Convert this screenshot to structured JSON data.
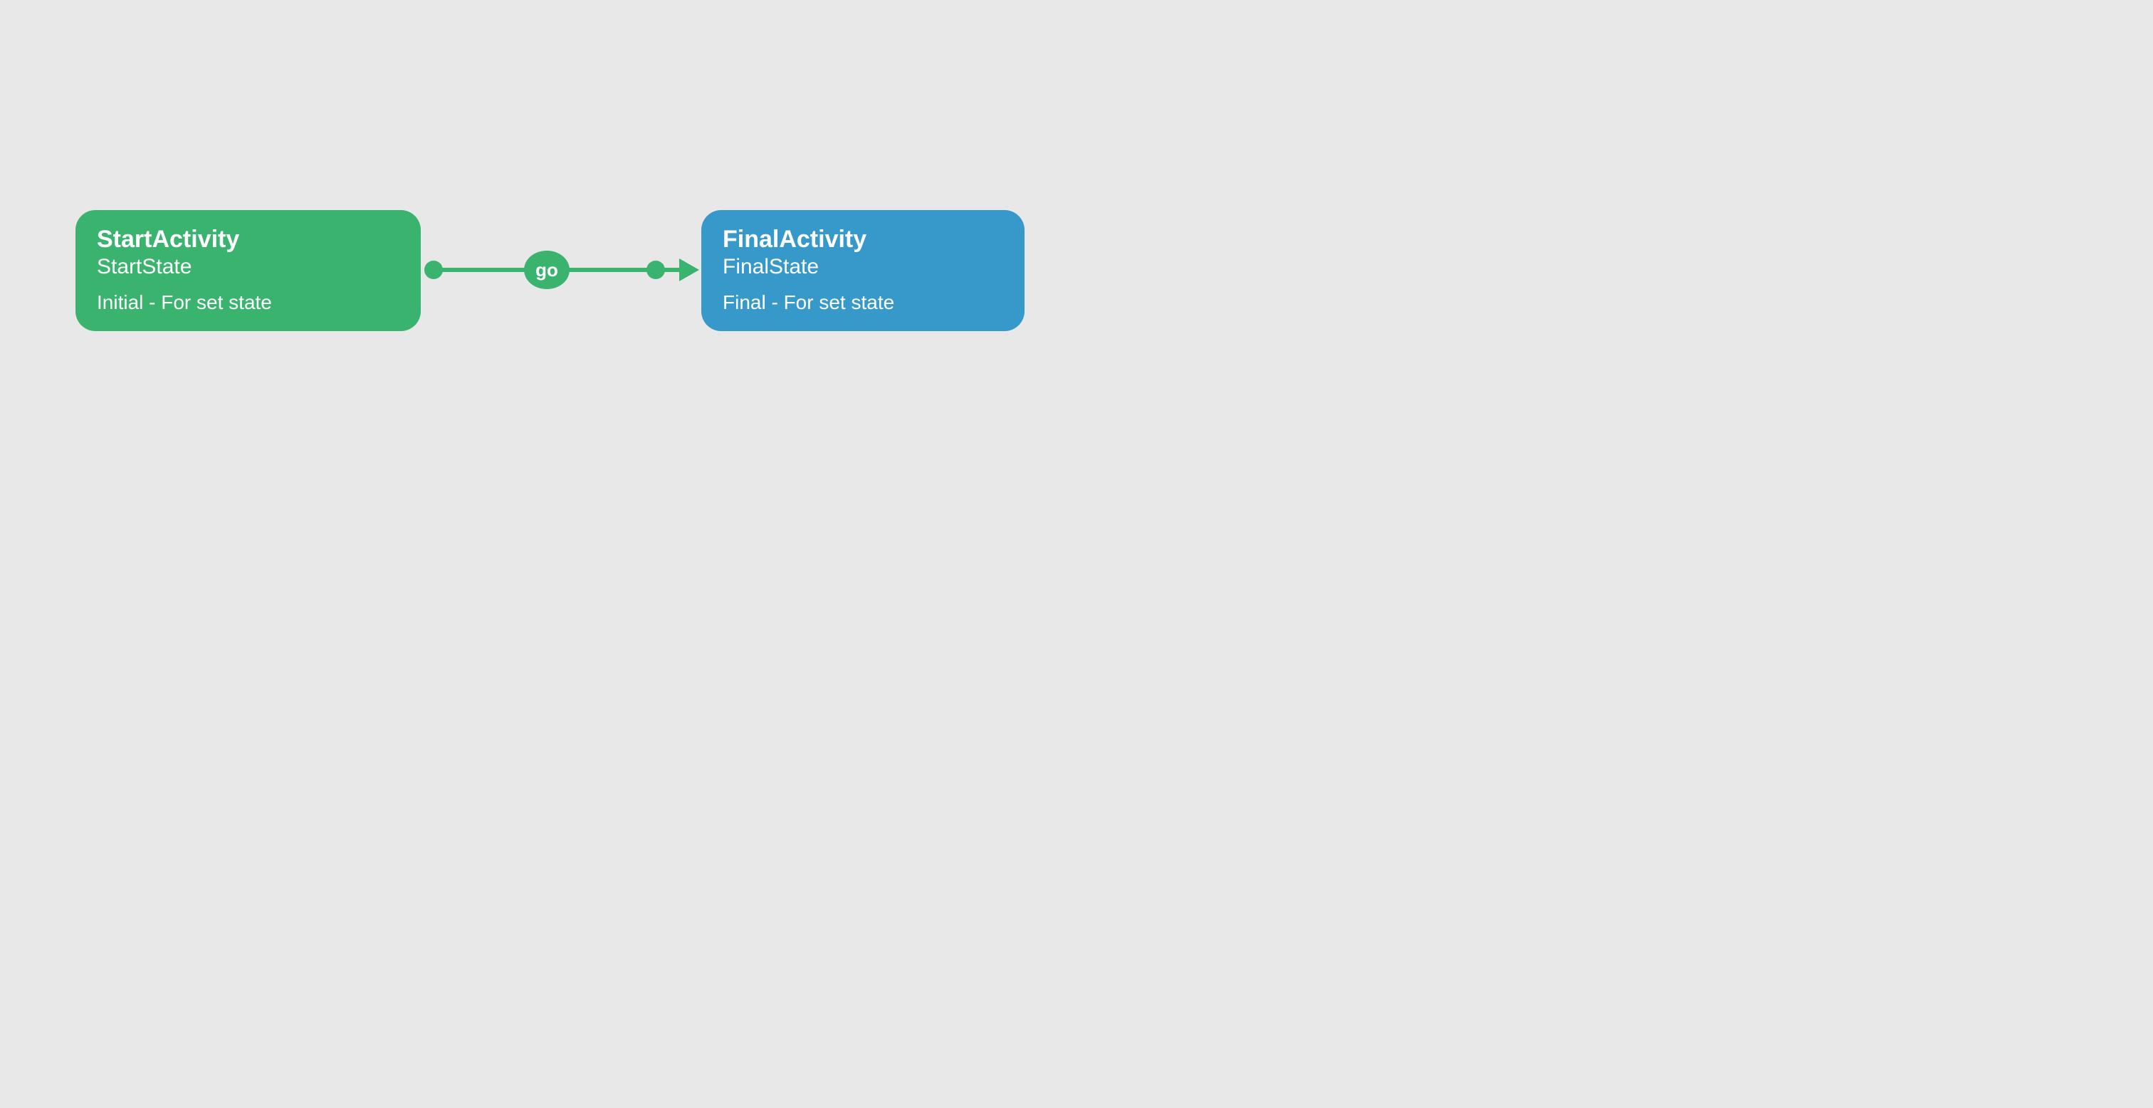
{
  "colors": {
    "green": "#39b36e",
    "blue": "#3699c9",
    "background": "#e8e8e8"
  },
  "nodes": {
    "start": {
      "title": "StartActivity",
      "subtitle": "StartState",
      "description": "Initial - For set state"
    },
    "final": {
      "title": "FinalActivity",
      "subtitle": "FinalState",
      "description": "Final - For set state"
    }
  },
  "edge": {
    "label": "go"
  }
}
